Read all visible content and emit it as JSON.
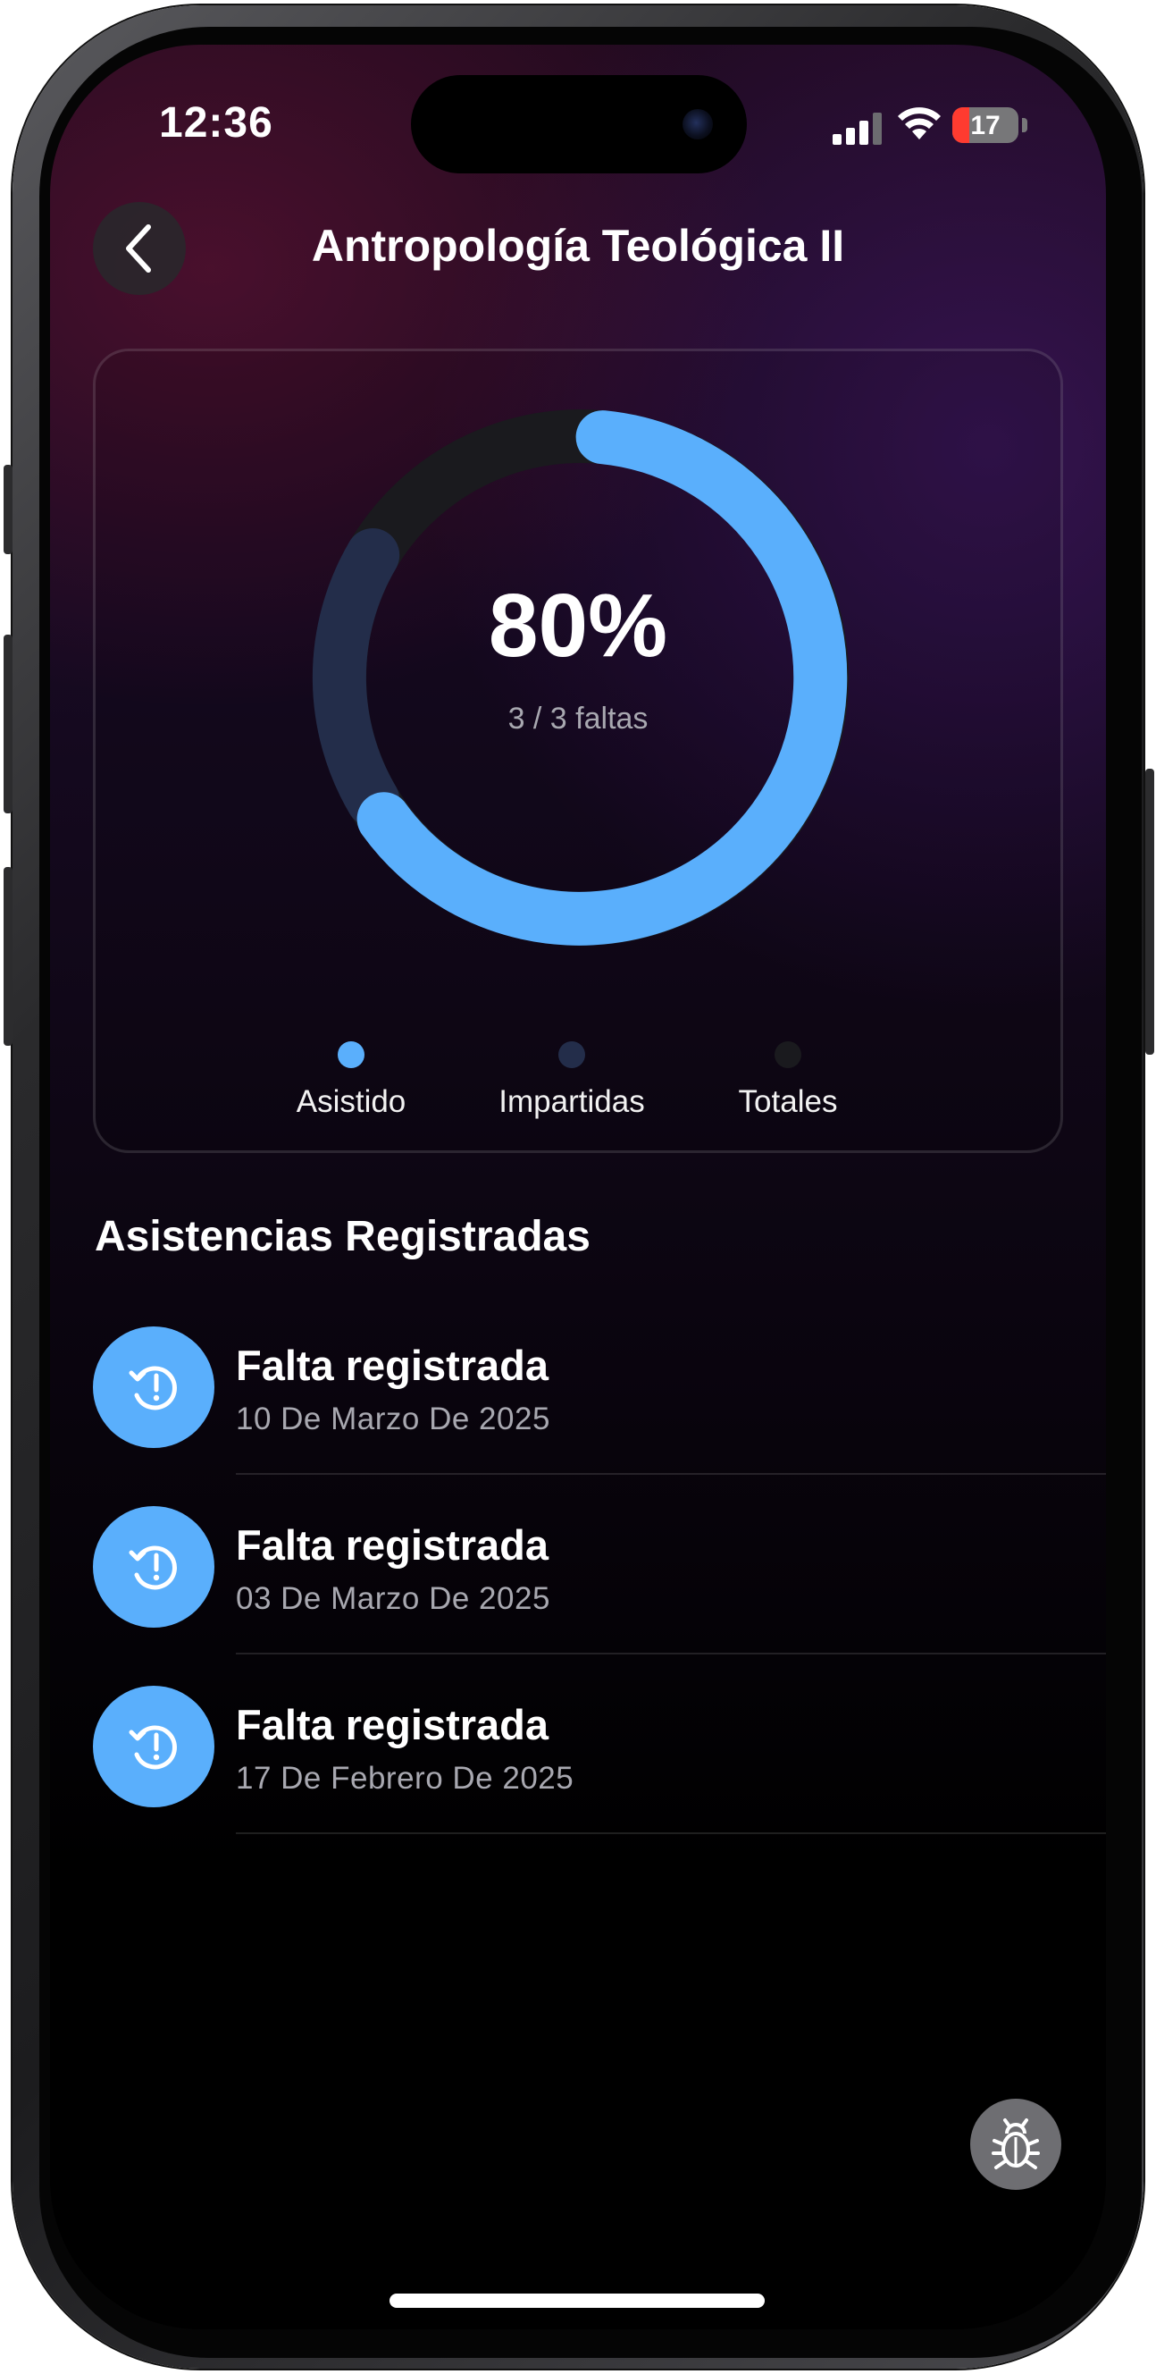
{
  "status_bar": {
    "time": "12:36",
    "battery": "17"
  },
  "header": {
    "title": "Antropología Teológica II"
  },
  "stats": {
    "percent": "80%",
    "faltas": "3 / 3 faltas",
    "attended_fraction": 0.8,
    "colors": {
      "asistido": "#5aaffc",
      "impartidas": "#232d4a",
      "totales": "#1a1a1e"
    },
    "legend": [
      {
        "label": "Asistido"
      },
      {
        "label": "Impartidas"
      },
      {
        "label": "Totales"
      }
    ]
  },
  "attendance": {
    "section_title": "Asistencias Registradas",
    "items": [
      {
        "title": "Falta registrada",
        "date": "10 De Marzo De 2025",
        "icon": "history-alert-icon"
      },
      {
        "title": "Falta registrada",
        "date": "03 De Marzo De 2025",
        "icon": "history-alert-icon"
      },
      {
        "title": "Falta registrada",
        "date": "17 De Febrero De 2025",
        "icon": "history-alert-icon"
      }
    ]
  },
  "debug_button": {
    "icon": "bug-icon"
  }
}
